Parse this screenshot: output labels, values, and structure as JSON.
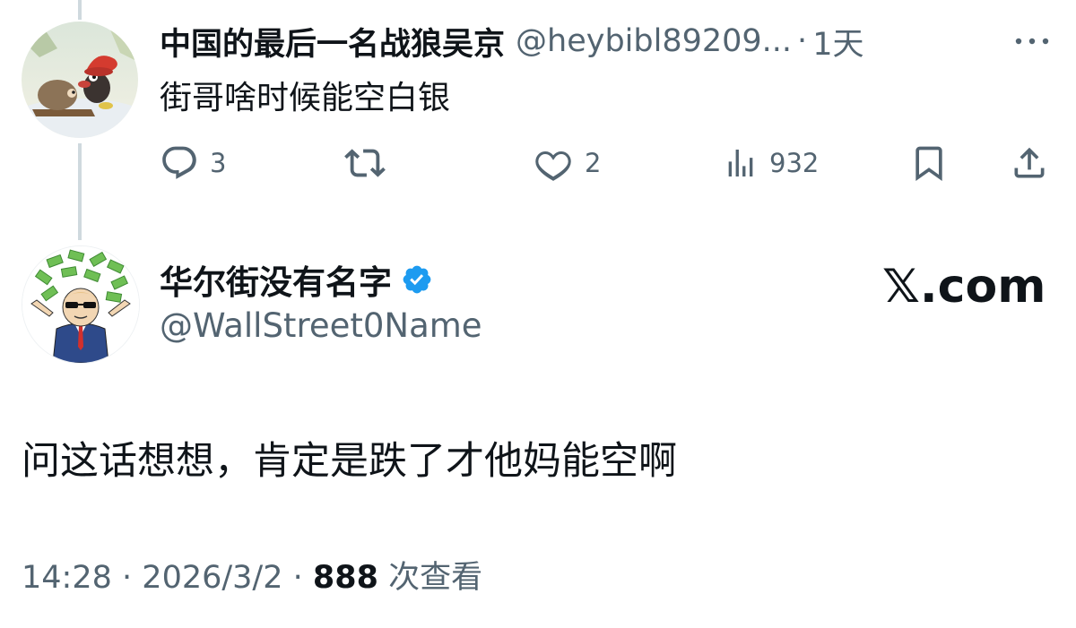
{
  "reply": {
    "author_name": "中国的最后一名战狼吴京",
    "handle": "@heybibl89209...",
    "separator": "·",
    "time": "1天",
    "text": "街哥啥时候能空白银",
    "actions": {
      "replies": "3",
      "retweets": "",
      "likes": "2",
      "views": "932"
    }
  },
  "tweet": {
    "author_name": "华尔街没有名字",
    "handle": "@WallStreet0Name",
    "verified": true,
    "text": "问这话想想，肯定是跌了才他妈能空啊",
    "time": "14:28",
    "separator1": "·",
    "date": "2026/3/2",
    "separator2": "·",
    "views_count": "888",
    "views_label": "次查看"
  },
  "watermark": {
    "brand": "𝕏.com"
  },
  "icons": {
    "reply": "reply-icon",
    "retweet": "retweet-icon",
    "like": "heart-icon",
    "views": "views-chart-icon",
    "bookmark": "bookmark-icon",
    "share": "share-icon",
    "more": "more-dots-icon",
    "verified": "verified-badge-icon"
  },
  "colors": {
    "text_primary": "#0f1419",
    "text_secondary": "#536471",
    "verified_blue": "#1d9bf0",
    "thread_line": "#cfd9de"
  }
}
